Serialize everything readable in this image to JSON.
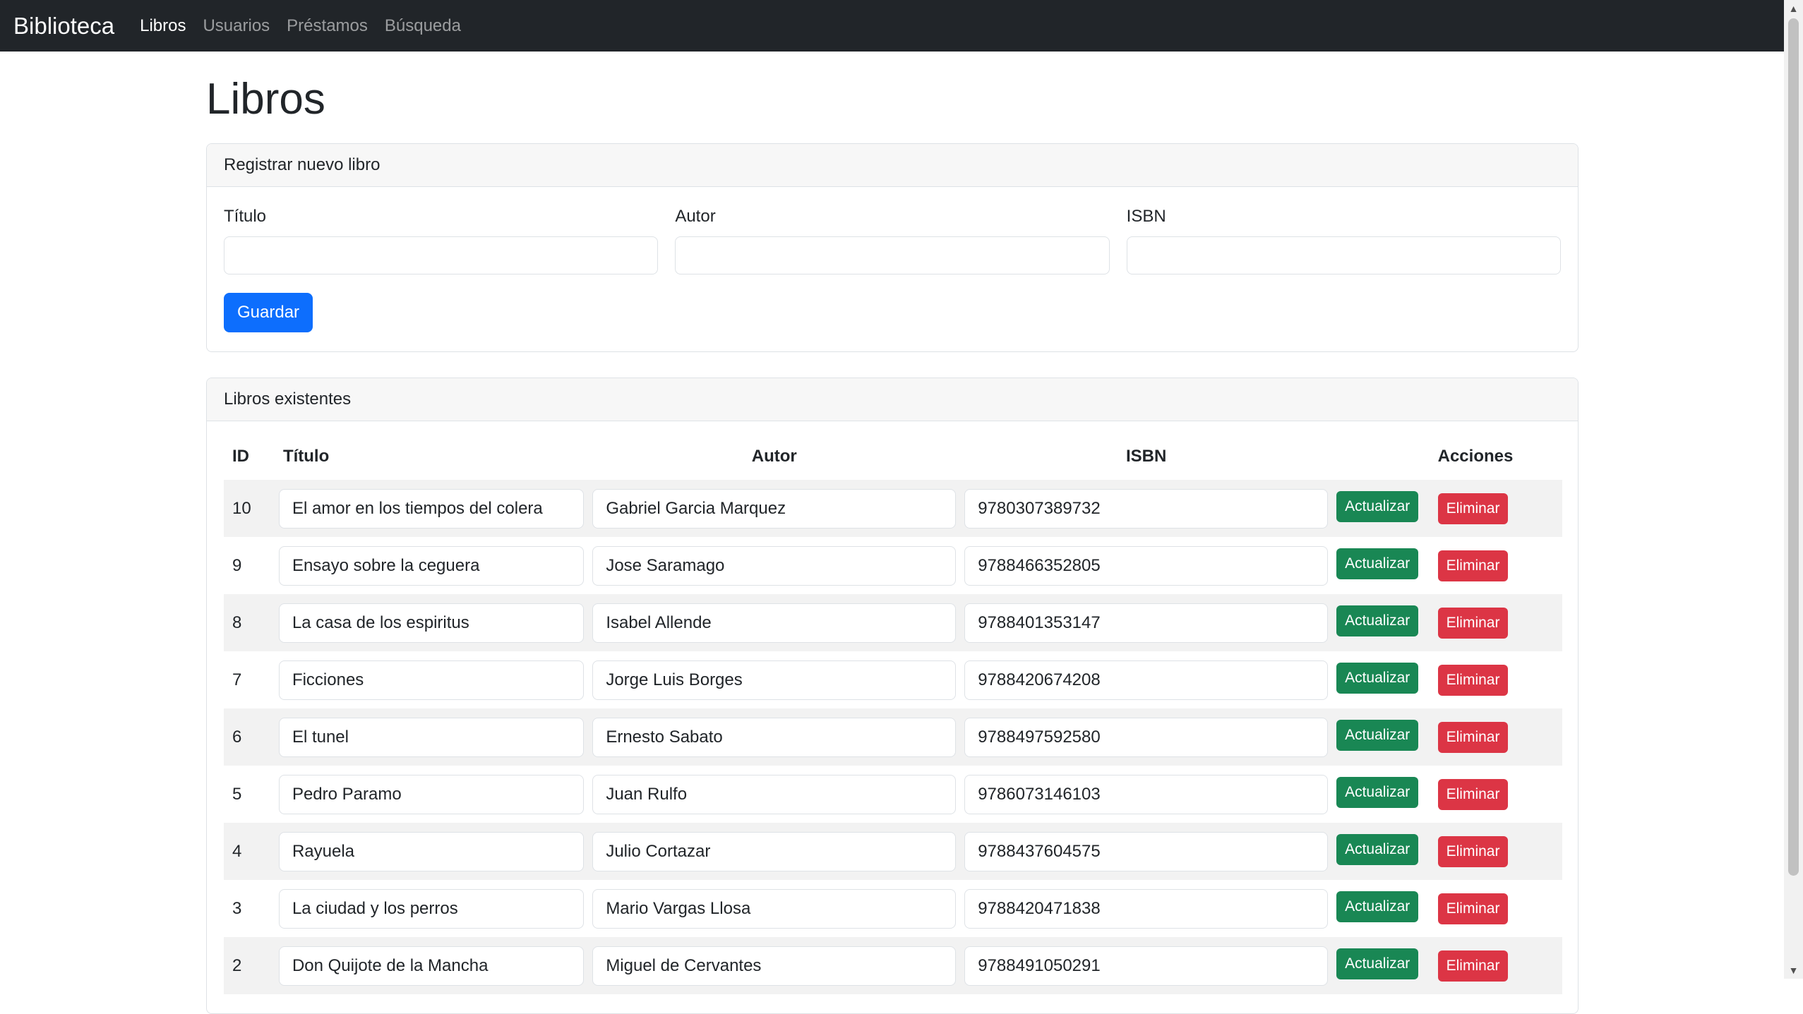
{
  "navbar": {
    "brand": "Biblioteca",
    "links": [
      {
        "label": "Libros",
        "active": true
      },
      {
        "label": "Usuarios",
        "active": false
      },
      {
        "label": "Préstamos",
        "active": false
      },
      {
        "label": "Búsqueda",
        "active": false
      }
    ]
  },
  "page_title": "Libros",
  "register_card": {
    "header": "Registrar nuevo libro",
    "fields": [
      {
        "label": "Título",
        "value": ""
      },
      {
        "label": "Autor",
        "value": ""
      },
      {
        "label": "ISBN",
        "value": ""
      }
    ],
    "save_label": "Guardar"
  },
  "list_card": {
    "header": "Libros existentes",
    "columns": [
      "ID",
      "Título",
      "Autor",
      "ISBN",
      "Acciones"
    ],
    "update_label": "Actualizar",
    "delete_label": "Eliminar",
    "rows": [
      {
        "id": "10",
        "titulo": "El amor en los tiempos del colera",
        "autor": "Gabriel Garcia Marquez",
        "isbn": "9780307389732"
      },
      {
        "id": "9",
        "titulo": "Ensayo sobre la ceguera",
        "autor": "Jose Saramago",
        "isbn": "9788466352805"
      },
      {
        "id": "8",
        "titulo": "La casa de los espiritus",
        "autor": "Isabel Allende",
        "isbn": "9788401353147"
      },
      {
        "id": "7",
        "titulo": "Ficciones",
        "autor": "Jorge Luis Borges",
        "isbn": "9788420674208"
      },
      {
        "id": "6",
        "titulo": "El tunel",
        "autor": "Ernesto Sabato",
        "isbn": "9788497592580"
      },
      {
        "id": "5",
        "titulo": "Pedro Paramo",
        "autor": "Juan Rulfo",
        "isbn": "9786073146103"
      },
      {
        "id": "4",
        "titulo": "Rayuela",
        "autor": "Julio Cortazar",
        "isbn": "9788437604575"
      },
      {
        "id": "3",
        "titulo": "La ciudad y los perros",
        "autor": "Mario Vargas Llosa",
        "isbn": "9788420471838"
      },
      {
        "id": "2",
        "titulo": "Don Quijote de la Mancha",
        "autor": "Miguel de Cervantes",
        "isbn": "9788491050291"
      }
    ]
  },
  "colors": {
    "navbar_bg": "#212529",
    "primary": "#0d6efd",
    "success": "#198754",
    "danger": "#dc3545"
  },
  "icons": {
    "scroll_up": "scroll-up-arrow-icon",
    "scroll_down": "scroll-down-arrow-icon"
  }
}
